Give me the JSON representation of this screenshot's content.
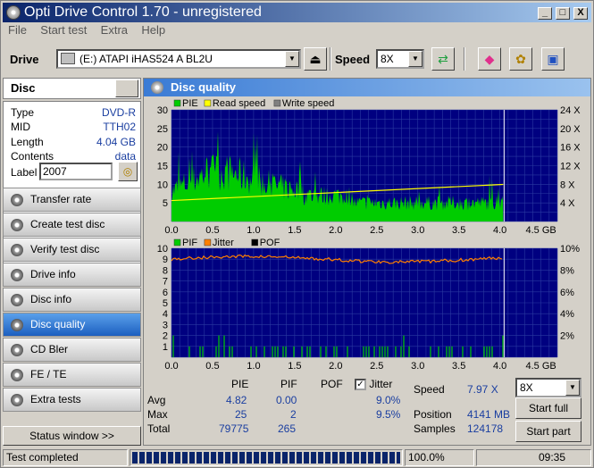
{
  "window": {
    "title": "Opti Drive Control 1.70 - unregistered",
    "min": "_",
    "max": "□",
    "close": "X"
  },
  "menu": [
    "File",
    "Start test",
    "Extra",
    "Help"
  ],
  "toolbar": {
    "drive_label": "Drive",
    "drive_value": "(E:)  ATAPI iHAS524   A BL2U",
    "speed_label": "Speed",
    "speed_value": "8X"
  },
  "disc": {
    "header": "Disc",
    "type_k": "Type",
    "type_v": "DVD-R",
    "mid_k": "MID",
    "mid_v": "TTH02",
    "length_k": "Length",
    "length_v": "4.04 GB",
    "contents_k": "Contents",
    "contents_v": "data",
    "label_k": "Label",
    "label_v": "2007"
  },
  "nav": [
    {
      "label": "Transfer rate",
      "active": false
    },
    {
      "label": "Create test disc",
      "active": false
    },
    {
      "label": "Verify test disc",
      "active": false
    },
    {
      "label": "Drive info",
      "active": false
    },
    {
      "label": "Disc info",
      "active": false
    },
    {
      "label": "Disc quality",
      "active": true
    },
    {
      "label": "CD Bler",
      "active": false
    },
    {
      "label": "FE / TE",
      "active": false
    },
    {
      "label": "Extra tests",
      "active": false
    }
  ],
  "status_window": "Status window >>",
  "main": {
    "title": "Disc quality"
  },
  "chart_data": [
    {
      "type": "area",
      "legend": [
        "PIE",
        "Read speed",
        "Write speed"
      ],
      "x_ticks": [
        "0.0",
        "0.5",
        "1.0",
        "1.5",
        "2.0",
        "2.5",
        "3.0",
        "3.5",
        "4.0",
        "4.5 GB"
      ],
      "y_ticks": [
        "5",
        "10",
        "15",
        "20",
        "25",
        "30"
      ],
      "y2_ticks": [
        "4 X",
        "8 X",
        "12 X",
        "16 X",
        "20 X",
        "24 X"
      ],
      "ylim": [
        0,
        30
      ],
      "xlim": [
        0,
        4.7
      ],
      "series": [
        {
          "name": "PIE",
          "avg": 4.82,
          "max": 25,
          "end_gb": 4.04
        },
        {
          "name": "Read speed",
          "start_x": 4.5,
          "end_x": 7.97
        }
      ],
      "colors": {
        "PIE": "#00cc00",
        "Read speed": "#ffff00",
        "Write speed": "#808080",
        "bg": "#000080"
      }
    },
    {
      "type": "bar",
      "legend": [
        "PIF",
        "Jitter",
        "POF"
      ],
      "x_ticks": [
        "0.0",
        "0.5",
        "1.0",
        "1.5",
        "2.0",
        "2.5",
        "3.0",
        "3.5",
        "4.0",
        "4.5 GB"
      ],
      "y_ticks": [
        "1",
        "2",
        "3",
        "4",
        "5",
        "6",
        "7",
        "8",
        "9",
        "10"
      ],
      "y2_ticks": [
        "2%",
        "4%",
        "6%",
        "8%",
        "10%"
      ],
      "ylim": [
        0,
        10
      ],
      "series": [
        {
          "name": "PIF",
          "avg": 0.0,
          "max": 2
        },
        {
          "name": "Jitter",
          "avg_percent": 9.0,
          "max_percent": 9.5
        }
      ],
      "colors": {
        "PIF": "#00cc00",
        "Jitter": "#ff8000",
        "POF": "#000000"
      }
    }
  ],
  "stats": {
    "h_pie": "PIE",
    "h_pif": "PIF",
    "h_pof": "POF",
    "h_jitter": "Jitter",
    "avg_k": "Avg",
    "max_k": "Max",
    "total_k": "Total",
    "avg_pie": "4.82",
    "avg_pif": "0.00",
    "avg_jit": "9.0%",
    "max_pie": "25",
    "max_pif": "2",
    "max_jit": "9.5%",
    "total_pie": "79775",
    "total_pif": "265"
  },
  "right": {
    "speed_k": "Speed",
    "speed_v": "7.97 X",
    "speed_sel": "8X",
    "position_k": "Position",
    "position_v": "4141 MB",
    "samples_k": "Samples",
    "samples_v": "124178",
    "start_full": "Start full",
    "start_part": "Start part"
  },
  "statusbar": {
    "text": "Test completed",
    "progress": "100.0%",
    "progress_fraction": 1.0,
    "time": "09:35"
  }
}
